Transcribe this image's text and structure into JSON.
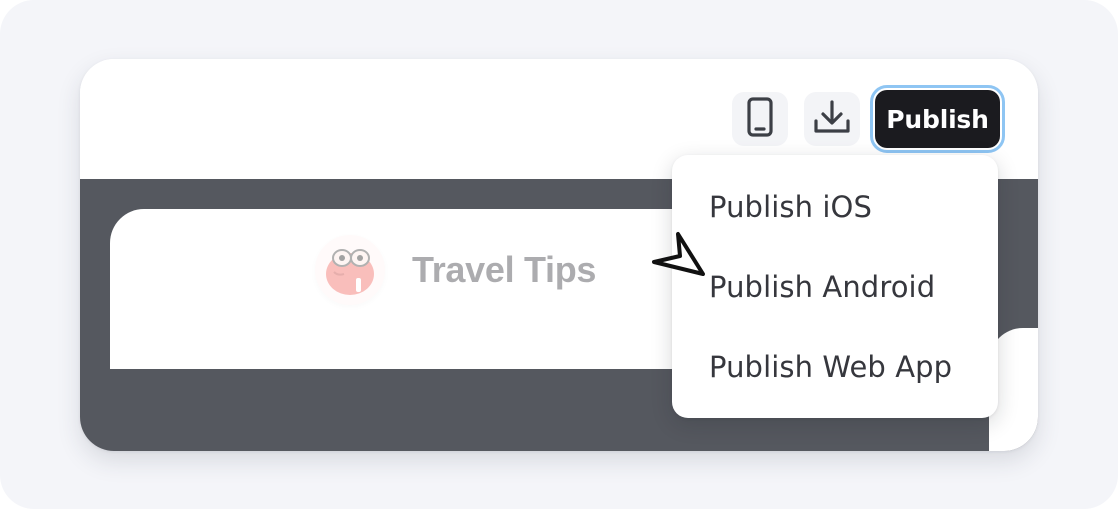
{
  "toolbar": {
    "preview_icon": "mobile-phone-icon",
    "download_icon": "download-icon",
    "publish_label": "Publish"
  },
  "publish_menu": {
    "items": [
      {
        "label": "Publish iOS"
      },
      {
        "label": "Publish Android"
      },
      {
        "label": "Publish Web App"
      }
    ]
  },
  "preview": {
    "title": "Travel Tips",
    "logo_icon": "mascot-with-glasses-icon"
  },
  "colors": {
    "backdrop": "#f4f5f9",
    "canvas": "#55585f",
    "publish_bg": "#1b1b1f",
    "focus_ring": "#8ec5f3"
  }
}
